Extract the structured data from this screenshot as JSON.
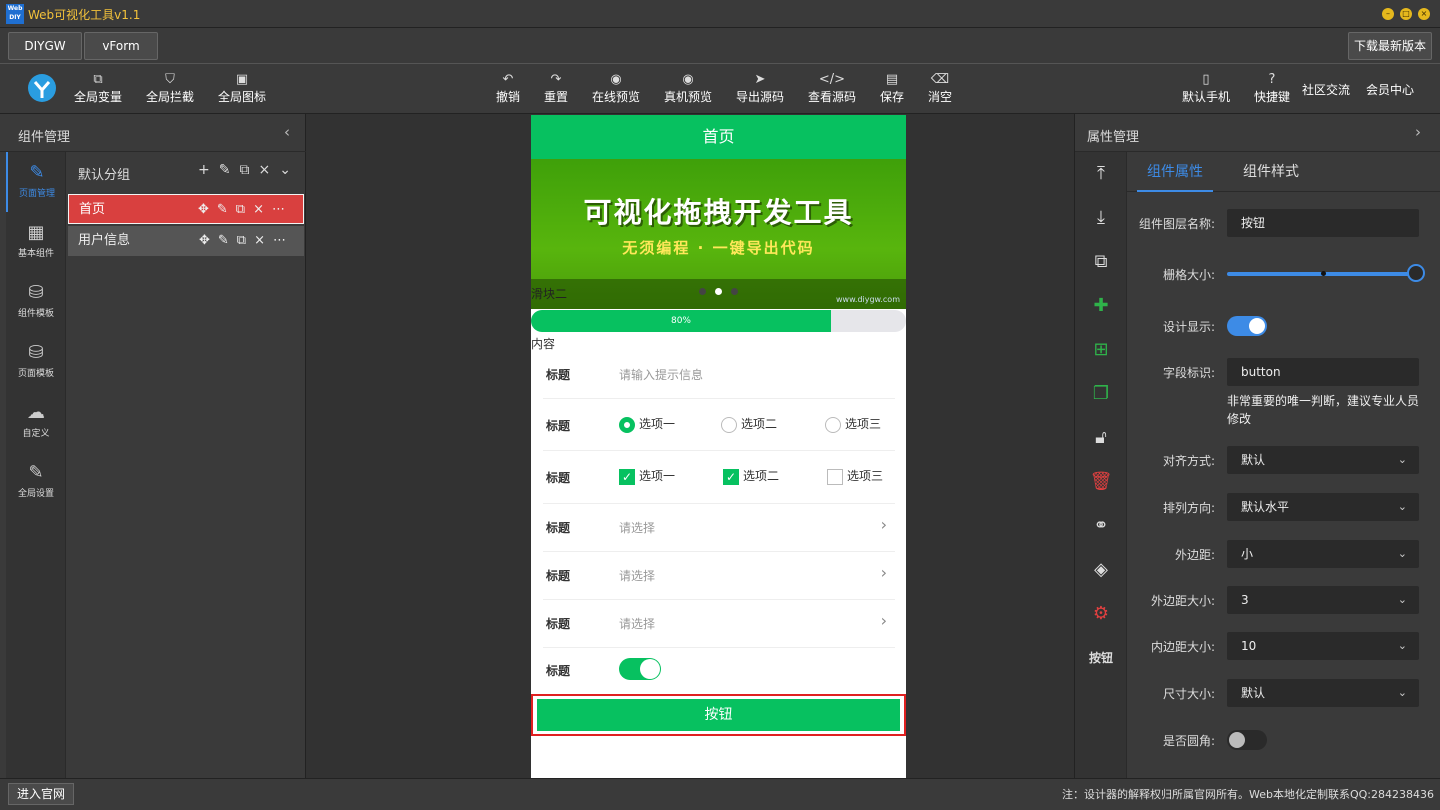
{
  "app": {
    "logo_text": "Web DIY",
    "title": "Web可视化工具v1.1"
  },
  "tabs": [
    "DIYGW",
    "vForm"
  ],
  "download_label": "下载最新版本",
  "toolbar": {
    "left": [
      {
        "label": "全局变量",
        "icon": "variable-icon"
      },
      {
        "label": "全局拦截",
        "icon": "shield-icon"
      },
      {
        "label": "全局图标",
        "icon": "image-icon"
      }
    ],
    "center": [
      {
        "label": "撤销",
        "icon": "undo-icon"
      },
      {
        "label": "重置",
        "icon": "redo-icon"
      },
      {
        "label": "在线预览",
        "icon": "eye-icon"
      },
      {
        "label": "真机预览",
        "icon": "eye-icon"
      },
      {
        "label": "导出源码",
        "icon": "send-icon"
      },
      {
        "label": "查看源码",
        "icon": "code-icon"
      },
      {
        "label": "保存",
        "icon": "save-icon"
      },
      {
        "label": "消空",
        "icon": "trash-icon"
      }
    ],
    "right": [
      {
        "label": "默认手机",
        "icon": "phone-icon"
      },
      {
        "label": "快捷键",
        "icon": "help-icon"
      },
      {
        "label": "社区交流",
        "icon": ""
      },
      {
        "label": "会员中心",
        "icon": ""
      }
    ]
  },
  "left_panel": {
    "title": "组件管理",
    "nav": [
      {
        "label": "页面管理",
        "icon": "pencil-icon",
        "active": true
      },
      {
        "label": "基本组件",
        "icon": "component-icon",
        "active": false
      },
      {
        "label": "组件模板",
        "icon": "database-icon",
        "active": false
      },
      {
        "label": "页面模板",
        "icon": "database-icon",
        "active": false
      },
      {
        "label": "自定义",
        "icon": "cloud-upload-icon",
        "active": false
      },
      {
        "label": "全局设置",
        "icon": "pencil-icon",
        "active": false
      }
    ],
    "group_name": "默认分组",
    "pages": [
      {
        "name": "首页",
        "selected": true
      },
      {
        "name": "用户信息",
        "selected": false
      }
    ]
  },
  "phone": {
    "header_title": "首页",
    "banner": {
      "title": "可视化拖拽开发工具",
      "subtitle": "无须编程 · 一键导出代码",
      "label": "滑块二",
      "site": "www.diygw.com",
      "dots": 3,
      "active_dot": 1
    },
    "progress": {
      "value": 0.8,
      "text": "80%"
    },
    "content_label": "内容",
    "form": {
      "input": {
        "label": "标题",
        "placeholder": "请输入提示信息"
      },
      "radio": {
        "label": "标题",
        "options": [
          "选项一",
          "选项二",
          "选项三"
        ],
        "checked": 0
      },
      "checkbox": {
        "label": "标题",
        "options": [
          "选项一",
          "选项二",
          "选项三"
        ],
        "checked": [
          true,
          true,
          false
        ]
      },
      "selects": [
        {
          "label": "标题",
          "placeholder": "请选择"
        },
        {
          "label": "标题",
          "placeholder": "请选择"
        },
        {
          "label": "标题",
          "placeholder": "请选择"
        }
      ],
      "switch": {
        "label": "标题",
        "on": true
      }
    },
    "button_label": "按钮"
  },
  "right_panel": {
    "title": "属性管理",
    "nav_caption": "按钮",
    "tabs": [
      "组件属性",
      "组件样式"
    ],
    "active_tab": 0,
    "props": {
      "layer_name": {
        "label": "组件图层名称:",
        "value": "按钮"
      },
      "grid": {
        "label": "栅格大小:",
        "value": 1.0
      },
      "design_show": {
        "label": "设计显示:",
        "on": true
      },
      "field_id": {
        "label": "字段标识:",
        "value": "button"
      },
      "field_hint": "非常重要的唯一判断，建议专业人员修改",
      "align": {
        "label": "对齐方式:",
        "value": "默认"
      },
      "direction": {
        "label": "排列方向:",
        "value": "默认水平"
      },
      "margin": {
        "label": "外边距:",
        "value": "小"
      },
      "margin_size": {
        "label": "外边距大小:",
        "value": "3"
      },
      "padding_size": {
        "label": "内边距大小:",
        "value": "10"
      },
      "size": {
        "label": "尺寸大小:",
        "value": "默认"
      },
      "rounded": {
        "label": "是否圆角:",
        "on": false
      }
    }
  },
  "status": {
    "site_button": "进入官网",
    "text": "注：设计器的解释权归所属官网所有。Web本地化定制联系QQ:284238436"
  },
  "colors": {
    "accent": "#3d8be6",
    "brand_green": "#07c160",
    "selected_page": "#d9403f",
    "highlight_border": "#e02020"
  }
}
